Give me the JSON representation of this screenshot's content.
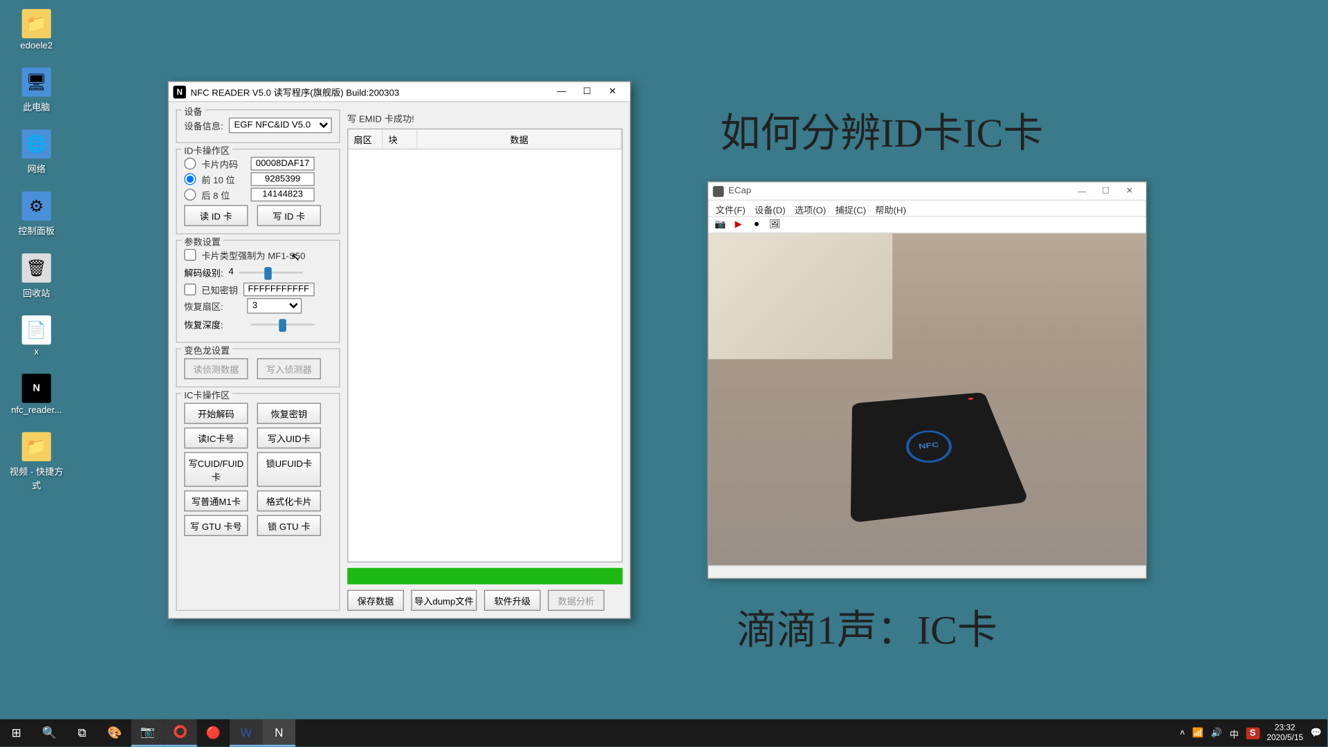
{
  "desktop": {
    "icons": [
      {
        "label": "edoele2"
      },
      {
        "label": "此电脑"
      },
      {
        "label": "网络"
      },
      {
        "label": "控制面板"
      },
      {
        "label": "回收站"
      },
      {
        "label": "x"
      },
      {
        "label": "nfc_reader..."
      },
      {
        "label": "视频 - 快捷方式"
      }
    ]
  },
  "nfc": {
    "title": "NFC READER V5.0 读写程序(旗舰版) Build:200303",
    "device_group": "设备",
    "device_info_label": "设备信息:",
    "device_info_value": "EGF NFC&ID V5.0",
    "id_group": "ID卡操作区",
    "card_inner_label": "卡片内码",
    "card_inner_value": "00008DAF17",
    "front10_label": "前 10 位",
    "front10_value": "9285399",
    "back8_label": "后 8 位",
    "back8_value": "14144823",
    "read_id_btn": "读 ID 卡",
    "write_id_btn": "写 ID 卡",
    "param_group": "参数设置",
    "card_type_label": "卡片类型强制为 MF1-S50",
    "decode_level_label": "解码级别:",
    "decode_level_value": "4",
    "known_key_label": "已知密钥",
    "known_key_value": "FFFFFFFFFFFF",
    "restore_sector_label": "恢复扇区:",
    "restore_sector_value": "3",
    "restore_depth_label": "恢复深度:",
    "chameleon_group": "变色龙设置",
    "read_detect_btn": "读侦测数据",
    "write_detect_btn": "写入侦测器",
    "ic_group": "IC卡操作区",
    "start_decode_btn": "开始解码",
    "restore_key_btn": "恢复密钥",
    "read_ic_btn": "读IC卡号",
    "write_uid_btn": "写入UID卡",
    "write_cuid_btn": "写CUID/FUID卡",
    "lock_ufuid_btn": "锁UFUID卡",
    "write_m1_btn": "写普通M1卡",
    "format_btn": "格式化卡片",
    "write_gtu_btn": "写 GTU 卡号",
    "lock_gtu_btn": "锁 GTU 卡",
    "status_text": "写 EMID 卡成功!",
    "col_sector": "扇区",
    "col_block": "块",
    "col_data": "数据",
    "save_data_btn": "保存数据",
    "import_dump_btn": "导入dump文件",
    "soft_upgrade_btn": "软件升级",
    "data_analysis_btn": "数据分析"
  },
  "ecap": {
    "title": "ECap",
    "menu": {
      "file": "文件(F)",
      "device": "设备(D)",
      "options": "选项(O)",
      "capture": "捕捉(C)",
      "help": "帮助(H)"
    },
    "nfc_text": "NFC"
  },
  "annotations": {
    "line1": "如何分辨ID卡IC卡",
    "line2": "滴滴1声：IC卡"
  },
  "taskbar": {
    "ime": "中",
    "ime_badge": "S",
    "time": "23:32",
    "date": "2020/5/15"
  }
}
